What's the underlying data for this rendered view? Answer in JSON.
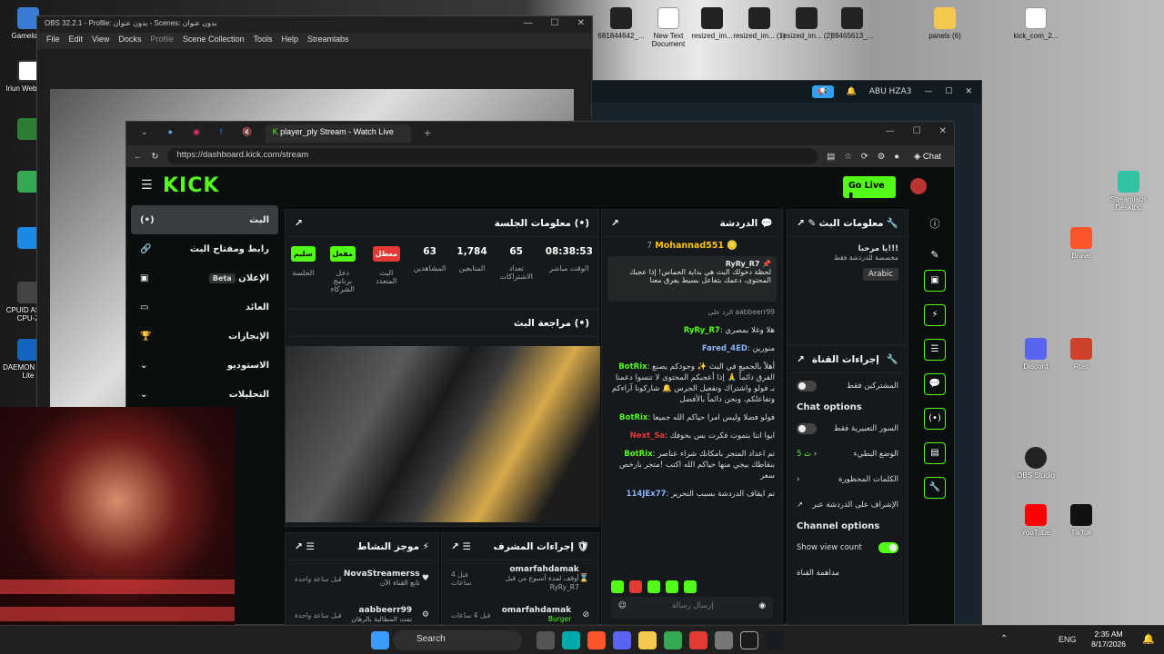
{
  "desktop": {
    "left_icons": [
      "Gameloop",
      "Iriun Webcam",
      "",
      "",
      "",
      "CPUID ASUS CPU-Z",
      "DAEMON Tools Lite"
    ],
    "top_icons": [
      "681844642_...",
      "New Text Document",
      "resized_im...",
      "resized_im... (1)",
      "resized_im... (2)",
      "88465613_...",
      "panels (6)",
      "kick_com_2..."
    ],
    "right_icons": [
      "Streamlabs Desktop",
      "Brave",
      "Discord",
      "Rust",
      "OBS Studio",
      "TikTok",
      "YouTube"
    ]
  },
  "obs": {
    "title": "OBS 32.2.1 - Profile: بدون عنوان - Scenes: بدون عنوان",
    "menu": [
      "File",
      "Edit",
      "View",
      "Docks",
      "Profile",
      "Scene Collection",
      "Tools",
      "Help",
      "Streamlabs"
    ]
  },
  "slobs": {
    "user": "ABU HZA3"
  },
  "browser": {
    "tab_title": "player_ply Stream - Watch Live",
    "url": "https://dashboard.kick.com/stream",
    "chat_label": "Chat"
  },
  "kick": {
    "logo": "KICK",
    "go_live": "Go Live",
    "nav": [
      {
        "label": "البث",
        "active": true
      },
      {
        "label": "رابط ومفتاح البث"
      },
      {
        "label": "الإعلان",
        "badge": "Beta"
      },
      {
        "label": "العائد"
      },
      {
        "label": "الإنجازات"
      },
      {
        "label": "الاستوديو"
      },
      {
        "label": "التحليلات"
      }
    ],
    "session": {
      "title": "معلومات الجلسة",
      "chips": [
        {
          "label": "سليم",
          "sub": "الجلسة",
          "color": "#53fc18"
        },
        {
          "label": "مفعل",
          "sub": "دخل برنامج الشركاء",
          "color": "#53fc18"
        },
        {
          "label": "معطل",
          "sub": "البث المتعدد",
          "color": "#e53935"
        }
      ],
      "stats": [
        {
          "value": "63",
          "label": "المشاهدين"
        },
        {
          "value": "1,784",
          "label": "المتابعين"
        },
        {
          "value": "65",
          "label": "تعداد الاشتراكات"
        },
        {
          "value": "08:38:53",
          "label": "الوقت مباشر"
        }
      ]
    },
    "preview_title": "مراجعة البث",
    "activity": {
      "title": "موجز النشاط",
      "items": [
        {
          "name": "NovaStreamerss",
          "time": "قبل ساعة واحدة",
          "desc": "تابع القناة الآن"
        },
        {
          "name": "aabbeerr99",
          "time": "قبل ساعة واحدة",
          "desc": "تمت المطالبة بالرهان"
        }
      ]
    },
    "mod": {
      "title": "إجراءات المشرف",
      "items": [
        {
          "name": "omarfahdamak",
          "time": "قبل 4 ساعات",
          "desc": "أوقف لمدة أسبوع من قبل RyRy_R7"
        },
        {
          "name": "omarfahdamak",
          "time": "قبل 4 ساعات",
          "desc": "Burger"
        }
      ]
    },
    "chat": {
      "title": "الدردشة",
      "top_user": "Mohannad551",
      "top_count": "7",
      "pinned_user": "RyRy_R7",
      "pinned_text": "لحظة دخولك البث هي بداية الحماس! إذا عجبك المحتوى، دعمك بتفاعل بسيط يفرق معنا",
      "messages": [
        {
          "user": "aabbeerr99",
          "reply": "الرد على",
          "text": "هلا وغلا بمصري"
        },
        {
          "user": "RyRy_R7",
          "text": "هلا وغلا بمصري",
          "color": "#53fc18"
        },
        {
          "user": "Fared_4ED",
          "text": "منورين",
          "color": "#8ab4f8"
        },
        {
          "user": "BotRix",
          "text": "أهلاً بالجميع في البث ✨ وجودكم يصنع الفرق دائماً 🙏 إذا أعجبكم المحتوى لا تنسوا دعمنا بـ فولو واشتراك وتفعيل الجرس 🔔 شاركونا آراءكم وتفاعلكم، ونحن دائماً بالأفضل",
          "color": "#53fc18"
        },
        {
          "user": "BotRix",
          "text": "فولو فضلا وليس امرا حياكم الله جميعا",
          "color": "#53fc18"
        },
        {
          "user": "Next_Sa",
          "text": "ايوا انتا بتموت فكرت بس بخوفك",
          "color": "#e53935"
        },
        {
          "user": "BotRix",
          "text": "تم اعداد المتجر بامكانك شراء عناصر بنقاطك بيجي منها حياكم الله اكتب !متجر بارخص سعر",
          "color": "#53fc18"
        },
        {
          "user": "114JEx77",
          "text": "تم ايقاف الدردشة بسبب التحرير",
          "color": "#8ab4f8"
        }
      ],
      "input_placeholder": "إرسال رسالة"
    },
    "info": {
      "title": "معلومات البث",
      "stream_title": "يا مرحبا!!!",
      "category": "مخصصة للدردشة فقط",
      "lang": "Arabic"
    },
    "channel": {
      "title": "إجراءات القناة",
      "subs_only": "المشتركين فقط",
      "chat_options": "Chat options",
      "emotes_only": "السور التعبيرية فقط",
      "slow_mode": "الوضع البطيء",
      "slow_value": "5 ث",
      "banned_words": "الكلمات المحظورة",
      "moderation": "الإشراف على الدردشة عبر",
      "channel_options": "Channel options",
      "show_view_count": "Show view count",
      "channel_raid": "مداهمة القناة"
    }
  },
  "taskbar": {
    "search": "Search",
    "lang": "ENG",
    "time": "2:35 AM",
    "date": "8/17/2026"
  }
}
